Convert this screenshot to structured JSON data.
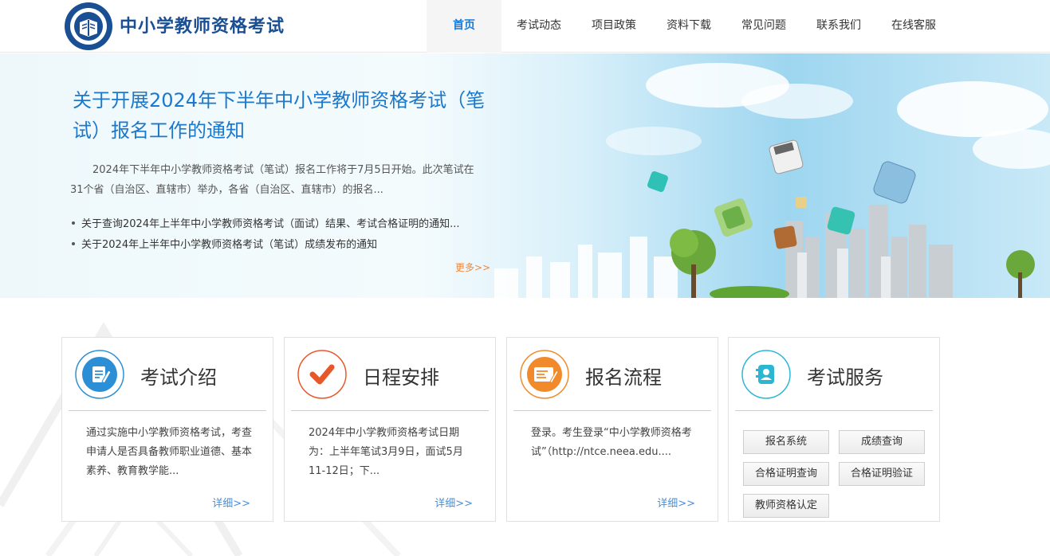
{
  "header": {
    "site_title": "中小学教师资格考试",
    "nav": [
      "首页",
      "考试动态",
      "项目政策",
      "资料下载",
      "常见问题",
      "联系我们",
      "在线客服"
    ]
  },
  "banner": {
    "headline": "关于开展2024年下半年中小学教师资格考试（笔试）报名工作的通知",
    "summary": "2024年下半年中小学教师资格考试（笔试）报名工作将于7月5日开始。此次笔试在31个省（自治区、直辖市）举办，各省（自治区、直辖市）的报名...",
    "news": [
      "关于查询2024年上半年中小学教师资格考试（面试）结果、考试合格证明的通知...",
      "关于2024年上半年中小学教师资格考试（笔试）成绩发布的通知"
    ],
    "more": "更多>>"
  },
  "cards": [
    {
      "title": "考试介绍",
      "text": "通过实施中小学教师资格考试，考查申请人是否具备教师职业道德、基本素养、教育教学能...",
      "detail": "详细>>",
      "icon": "document-edit-icon",
      "color": "#2c8fd6"
    },
    {
      "title": "日程安排",
      "text": "2024年中小学教师资格考试日期为：上半年笔试3月9日，面试5月11-12日；下...",
      "detail": "详细>>",
      "icon": "checkmark-icon",
      "color": "#e8572a"
    },
    {
      "title": "报名流程",
      "text": "登录。考生登录“中小学教师资格考试”（http://ntce.neea.edu....",
      "detail": "详细>>",
      "icon": "form-pen-icon",
      "color": "#f08a2a"
    },
    {
      "title": "考试服务",
      "icon": "contact-book-icon",
      "color": "#2bb7d4"
    }
  ],
  "services": [
    "报名系统",
    "成绩查询",
    "合格证明查询",
    "合格证明验证",
    "教师资格认定"
  ],
  "colors": {
    "brand": "#1a4f93",
    "accent": "#1679d8",
    "more": "#f0873b",
    "link": "#4b8fd6"
  }
}
